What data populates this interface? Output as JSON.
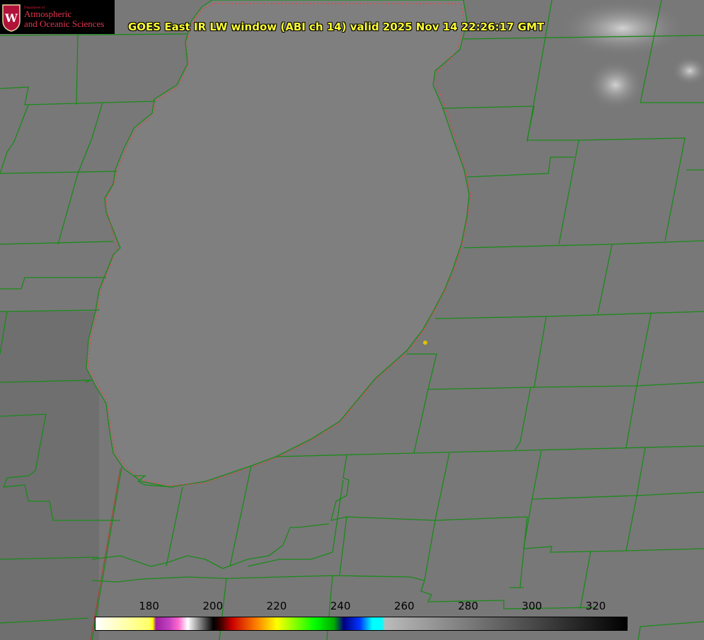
{
  "title": "GOES East IR LW window (ABI ch 14) valid 2025 Nov 14 22:26:17 GMT",
  "logo": {
    "department": "Department of",
    "line1": "Atmospheric",
    "line2": "and Oceanic Sciences",
    "seal_letter": "W"
  },
  "colorbar": {
    "tick_labels": [
      "180",
      "200",
      "220",
      "240",
      "260",
      "280",
      "300",
      "320"
    ],
    "range": [
      163,
      330
    ]
  },
  "colors": {
    "boundaries": "#1a8a1a",
    "shoreline_dotted": "#ff3333",
    "title_text": "#ffff33",
    "marker": "#d8c400"
  }
}
